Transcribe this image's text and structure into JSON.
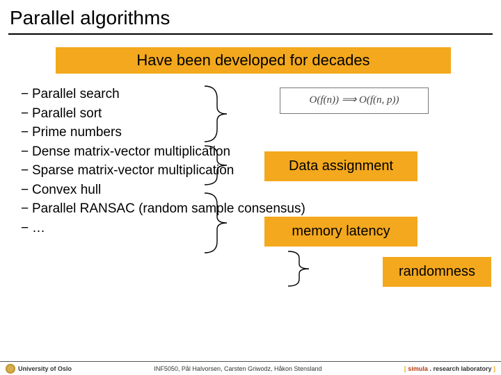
{
  "title": "Parallel algorithms",
  "banner": "Have been developed for decades",
  "items": [
    "Parallel search",
    "Parallel sort",
    "Prime numbers",
    "Dense matrix-vector multiplication",
    "Sparse matrix-vector multiplication",
    "Convex hull",
    "Parallel RANSAC (random sample consensus)",
    "…"
  ],
  "formula": "O(f(n)) ⟹ O(f(n, p))",
  "tags": {
    "data_assignment": "Data assignment",
    "memory_latency": "memory latency",
    "randomness": "randomness"
  },
  "footer": {
    "left": "University of Oslo",
    "mid": "INF5050, Pål Halvorsen, Carsten Griwodz, Håkon Stensland",
    "right_open": "[ ",
    "right_brand1": "simula",
    "right_dot": " . ",
    "right_brand2": "research laboratory",
    "right_close": " ]"
  }
}
